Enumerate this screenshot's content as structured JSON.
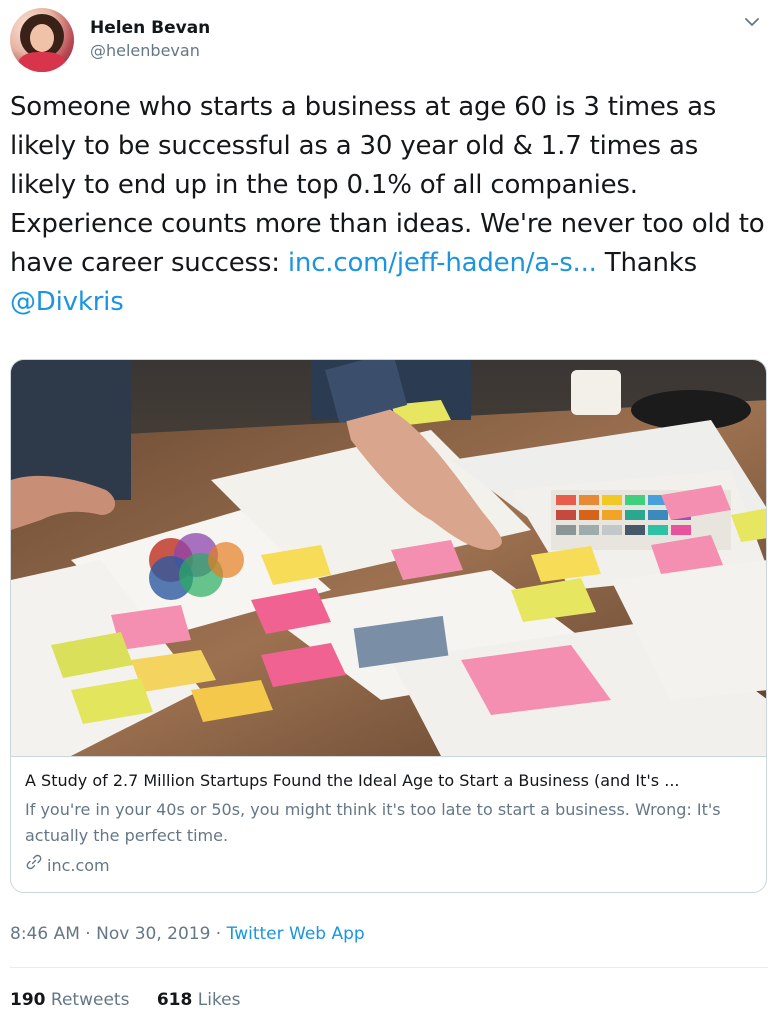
{
  "author": {
    "display_name": "Helen Bevan",
    "handle": "@helenbevan"
  },
  "tweet": {
    "text_before": "Someone who starts a business at age 60 is 3 times as likely to be successful as a 30 year old & 1.7 times as likely to end up in the top 0.1% of all companies. Experience counts more than ideas. We're never too old to have career success: ",
    "link_text": "inc.com/jeff-haden/a-s...",
    "text_middle": " Thanks ",
    "mention": "@Divkris"
  },
  "card": {
    "title": "A Study of 2.7 Million Startups Found the Ideal Age to Start a Business (and It's ...",
    "description": "If you're in your 40s or 50s, you might think it's too late to start a business. Wrong: It's actually the perfect time.",
    "domain": "inc.com",
    "image_alt": "people arranging papers and sticky notes on a wooden table"
  },
  "meta": {
    "time": "8:46 AM",
    "separator1": " · ",
    "date": "Nov 30, 2019",
    "separator2": " · ",
    "source": "Twitter Web App"
  },
  "stats": {
    "retweets_count": "190",
    "retweets_label": "Retweets",
    "likes_count": "618",
    "likes_label": "Likes"
  },
  "colors": {
    "link": "#1b95e0",
    "secondary_text": "#657786",
    "border": "#ccd6dd"
  },
  "icons": {
    "caret": "chevron-down-icon",
    "card_link": "link-icon"
  }
}
